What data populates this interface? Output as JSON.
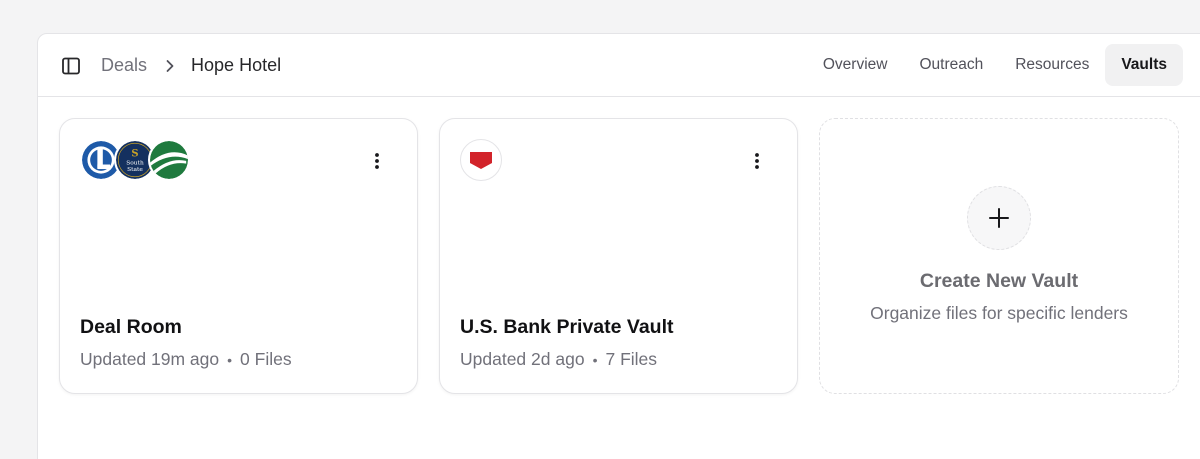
{
  "breadcrumb": {
    "parent": "Deals",
    "current": "Hope Hotel"
  },
  "tabs": [
    {
      "label": "Overview",
      "active": false
    },
    {
      "label": "Outreach",
      "active": false
    },
    {
      "label": "Resources",
      "active": false
    },
    {
      "label": "Vaults",
      "active": true
    }
  ],
  "vaults": [
    {
      "title": "Deal Room",
      "updated": "Updated 19m ago",
      "files": "0 Files",
      "logos": [
        "lender-logo-blue-c",
        "southstate-logo",
        "lender-logo-green"
      ],
      "logo_text": "South State"
    },
    {
      "title": "U.S. Bank Private Vault",
      "updated": "Updated 2d ago",
      "files": "7 Files",
      "logos": [
        "us-bank-shield-logo"
      ]
    }
  ],
  "create_vault": {
    "title": "Create New Vault",
    "subtitle": "Organize files for specific lenders"
  },
  "colors": {
    "accent_blue": "#1e5aa8",
    "navy": "#14305f",
    "green": "#1f7a3e",
    "red": "#d2232a"
  },
  "icons": [
    "sidebar-toggle-icon",
    "chevron-right-icon",
    "more-vertical-icon",
    "plus-icon"
  ]
}
